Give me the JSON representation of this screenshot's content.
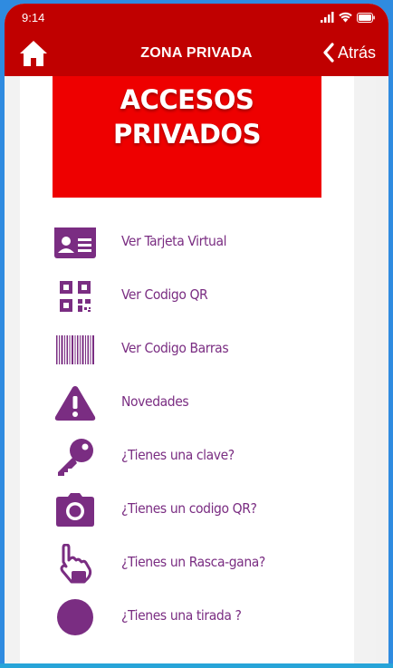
{
  "status_bar": {
    "time": "9:14"
  },
  "nav": {
    "title": "ZONA PRIVADA",
    "back_label": "Atrás"
  },
  "banner": {
    "title": "ACCESOS PRIVADOS",
    "color": "#ee0000"
  },
  "colors": {
    "header": "#c00000",
    "accent": "#7a2d82"
  },
  "menu": {
    "items": [
      {
        "label": "Ver Tarjeta Virtual",
        "icon": "id-card-icon"
      },
      {
        "label": "Ver Codigo QR",
        "icon": "qr-code-icon"
      },
      {
        "label": "Ver Codigo Barras",
        "icon": "barcode-icon"
      },
      {
        "label": "Novedades",
        "icon": "warning-icon"
      },
      {
        "label": "¿Tienes una clave?",
        "icon": "key-icon"
      },
      {
        "label": "¿Tienes un codigo QR?",
        "icon": "camera-icon"
      },
      {
        "label": "¿Tienes un Rasca-gana?",
        "icon": "hand-pointer-icon"
      },
      {
        "label": "¿Tienes una tirada ?",
        "icon": "circle-icon"
      }
    ]
  }
}
